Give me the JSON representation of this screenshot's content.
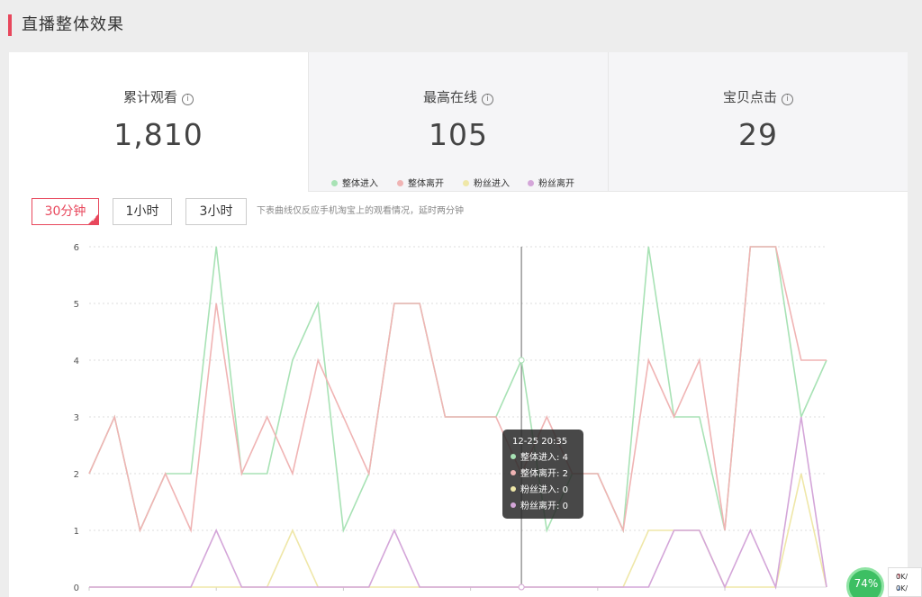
{
  "header": {
    "title": "直播整体效果"
  },
  "stats": [
    {
      "label": "累计观看",
      "info": "i",
      "value": "1,810"
    },
    {
      "label": "最高在线",
      "info": "i",
      "value": "105"
    },
    {
      "label": "宝贝点击",
      "info": "i",
      "value": "29"
    }
  ],
  "controls": {
    "buttons": [
      "30分钟",
      "1小时",
      "3小时"
    ],
    "selected": "30分钟",
    "note": "下表曲线仅反应手机淘宝上的观看情况，延时两分钟"
  },
  "tooltip": {
    "time": "12-25 20:35",
    "rows": [
      {
        "label": "整体进入:",
        "value": "4"
      },
      {
        "label": "整体离开:",
        "value": "2"
      },
      {
        "label": "粉丝进入:",
        "value": "0"
      },
      {
        "label": "粉丝离开:",
        "value": "0"
      }
    ]
  },
  "monitor": {
    "percent": "74%",
    "up": "0K/",
    "down": "0K/",
    "up_arrow": "↑",
    "down_arrow": "↓"
  },
  "colors": {
    "accent": "#e8475c",
    "series": [
      "#a8e2b5",
      "#f0b4b4",
      "#efe7a8",
      "#d4a6d9"
    ]
  },
  "chart_data": {
    "type": "line",
    "ylim": [
      0,
      6
    ],
    "yticks": [
      0,
      1,
      2,
      3,
      4,
      5,
      6
    ],
    "grid": true,
    "legend_position": "top-center",
    "highlight_index": 17,
    "series": [
      {
        "name": "整体进入",
        "values": [
          2,
          3,
          1,
          2,
          2,
          6,
          2,
          2,
          4,
          5,
          1,
          2,
          5,
          5,
          3,
          3,
          3,
          4,
          1,
          2,
          2,
          1,
          6,
          3,
          3,
          1,
          6,
          6,
          3,
          4
        ]
      },
      {
        "name": "整体离开",
        "values": [
          2,
          3,
          1,
          2,
          1,
          5,
          2,
          3,
          2,
          4,
          3,
          2,
          5,
          5,
          3,
          3,
          3,
          2,
          3,
          2,
          2,
          1,
          4,
          3,
          4,
          1,
          6,
          6,
          4,
          4
        ]
      },
      {
        "name": "粉丝进入",
        "values": [
          0,
          0,
          0,
          0,
          0,
          0,
          0,
          0,
          1,
          0,
          0,
          0,
          0,
          0,
          0,
          0,
          0,
          0,
          0,
          0,
          0,
          0,
          1,
          1,
          1,
          0,
          0,
          0,
          2,
          0
        ]
      },
      {
        "name": "粉丝离开",
        "values": [
          0,
          0,
          0,
          0,
          0,
          1,
          0,
          0,
          0,
          0,
          0,
          0,
          1,
          0,
          0,
          0,
          0,
          0,
          0,
          0,
          0,
          0,
          0,
          1,
          1,
          0,
          1,
          0,
          3,
          0
        ]
      }
    ]
  }
}
